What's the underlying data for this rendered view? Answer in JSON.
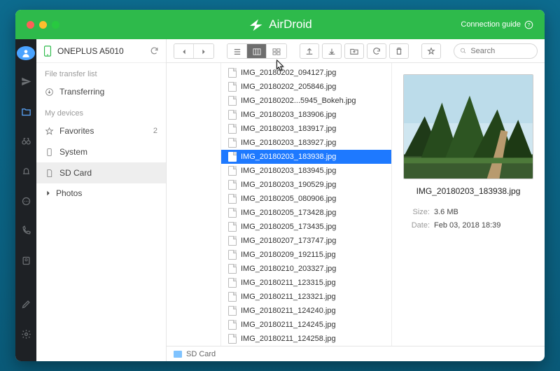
{
  "app": {
    "name": "AirDroid",
    "connection_guide": "Connection guide"
  },
  "device": {
    "name": "ONEPLUS A5010"
  },
  "sidebar": {
    "section_transfer": "File transfer list",
    "transferring": "Transferring",
    "section_devices": "My devices",
    "favorites": {
      "label": "Favorites",
      "count": "2"
    },
    "system": "System",
    "sdcard": "SD Card",
    "photos": "Photos"
  },
  "search": {
    "placeholder": "Search"
  },
  "files": [
    "IMG_20180202_094127.jpg",
    "IMG_20180202_205846.jpg",
    "IMG_20180202...5945_Bokeh.jpg",
    "IMG_20180203_183906.jpg",
    "IMG_20180203_183917.jpg",
    "IMG_20180203_183927.jpg",
    "IMG_20180203_183938.jpg",
    "IMG_20180203_183945.jpg",
    "IMG_20180203_190529.jpg",
    "IMG_20180205_080906.jpg",
    "IMG_20180205_173428.jpg",
    "IMG_20180205_173435.jpg",
    "IMG_20180207_173747.jpg",
    "IMG_20180209_192115.jpg",
    "IMG_20180210_203327.jpg",
    "IMG_20180211_123315.jpg",
    "IMG_20180211_123321.jpg",
    "IMG_20180211_124240.jpg",
    "IMG_20180211_124245.jpg",
    "IMG_20180211_124258.jpg"
  ],
  "selected_index": 6,
  "preview": {
    "name": "IMG_20180203_183938.jpg",
    "size_label": "Size:",
    "size": "3.6 MB",
    "date_label": "Date:",
    "date": "Feb 03, 2018 18:39"
  },
  "status": {
    "path": "SD Card"
  }
}
